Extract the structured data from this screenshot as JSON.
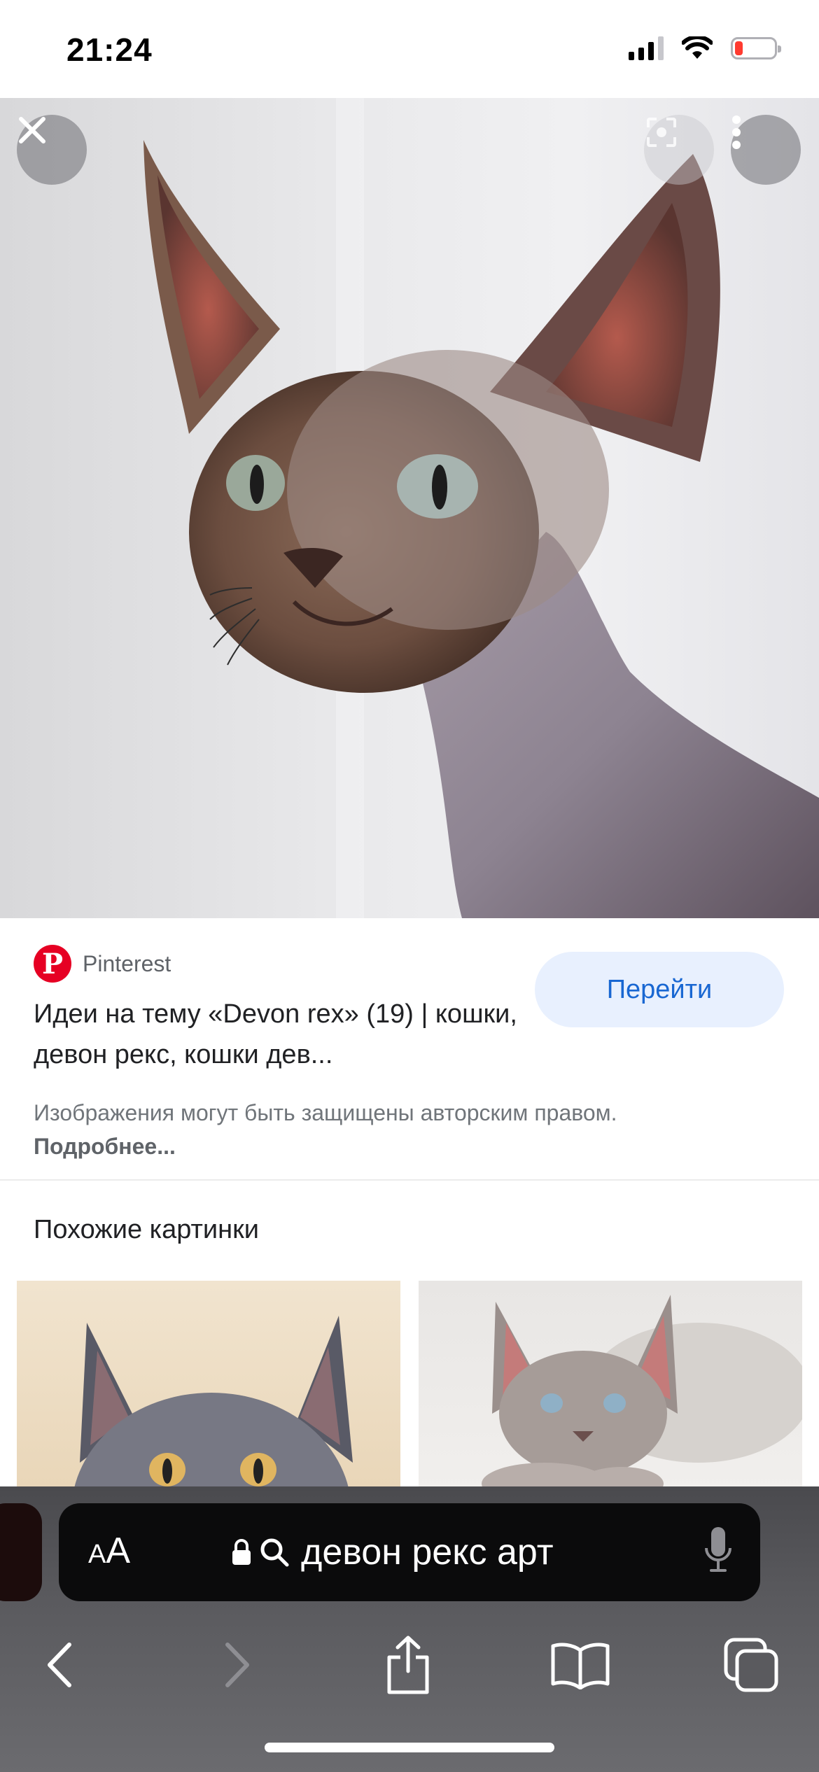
{
  "status_bar": {
    "time": "21:24",
    "battery_level": 0.2,
    "battery_color": "#ff3b30"
  },
  "image_viewer": {
    "close_icon": "close-icon",
    "lens_icon": "lens-icon",
    "more_icon": "more-vert-icon"
  },
  "result": {
    "source_name": "Pinterest",
    "source_logo_letter": "P",
    "title": "Идеи на тему «Devon rex» (19) | кошки, девон рекс, кошки дев...",
    "go_label": "Перейти",
    "copyright_text": "Изображения могут быть защищены авторским правом.",
    "copyright_link": "Подробнее..."
  },
  "similar": {
    "section_title": "Похожие картинки"
  },
  "browser": {
    "text_size_label_small": "A",
    "text_size_label_large": "A",
    "address": "девон рекс арт",
    "icons": [
      "back-icon",
      "forward-icon",
      "share-icon",
      "bookmarks-icon",
      "tabs-icon",
      "lock-icon",
      "search-icon",
      "mic-icon"
    ]
  },
  "colors": {
    "brand_pinterest": "#e60023",
    "accent_blue": "#1967d2",
    "button_bg": "#e8f0fe"
  }
}
